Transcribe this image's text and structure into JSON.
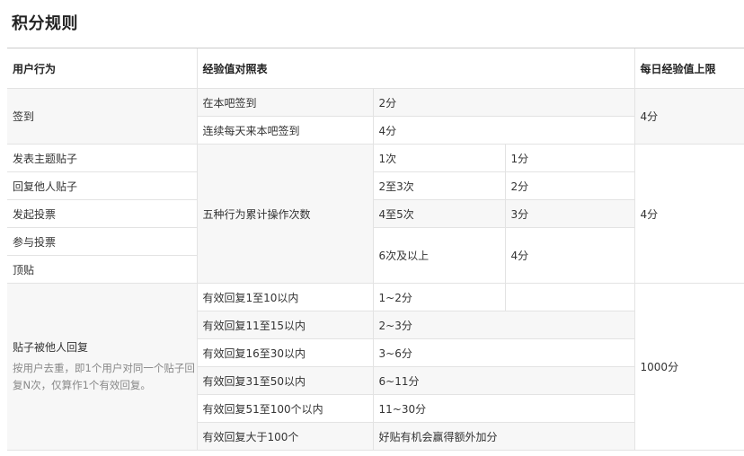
{
  "page_title": "积分规则",
  "headers": {
    "behavior": "用户行为",
    "table": "经验值对照表",
    "limit": "每日经验值上限"
  },
  "sign": {
    "behavior": "签到",
    "rows": [
      {
        "item": "在本吧签到",
        "points": "2分"
      },
      {
        "item": "连续每天来本吧签到",
        "points": "4分"
      }
    ],
    "limit": "4分"
  },
  "actions": {
    "behaviors": [
      "发表主题贴子",
      "回复他人贴子",
      "发起投票",
      "参与投票",
      "顶贴"
    ],
    "middle": "五种行为累计操作次数",
    "rows": [
      {
        "count": "1次",
        "points": "1分"
      },
      {
        "count": "2至3次",
        "points": "2分"
      },
      {
        "count": "4至5次",
        "points": "3分"
      },
      {
        "count": "6次及以上",
        "points": "4分"
      }
    ],
    "limit": "4分"
  },
  "replies": {
    "behavior": "贴子被他人回复",
    "note": "按用户去重，即1个用户对同一个贴子回复N次，仅算作1个有效回复。",
    "rows": [
      {
        "range": "有效回复1至10以内",
        "points": "1~2分"
      },
      {
        "range": "有效回复11至15以内",
        "points": "2~3分"
      },
      {
        "range": "有效回复16至30以内",
        "points": "3~6分"
      },
      {
        "range": "有效回复31至50以内",
        "points": "6~11分"
      },
      {
        "range": "有效回复51至100个以内",
        "points": "11~30分"
      },
      {
        "range": "有效回复大于100个",
        "points": "好贴有机会赢得额外加分"
      }
    ],
    "limit": "1000分"
  }
}
